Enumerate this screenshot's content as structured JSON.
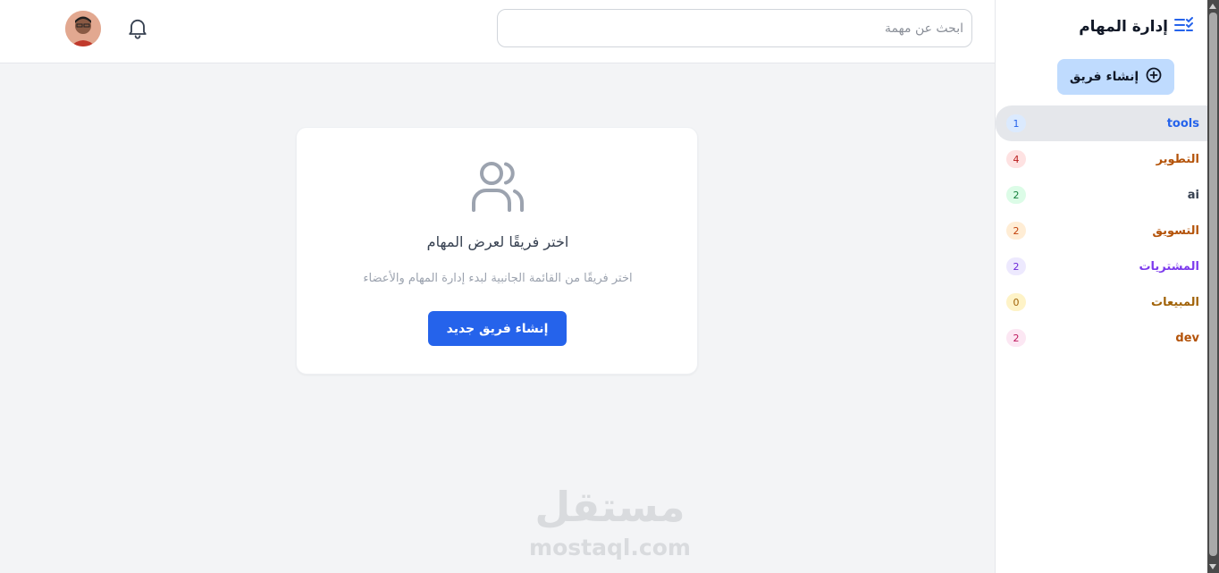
{
  "header": {
    "search_placeholder": "ابحث عن مهمة"
  },
  "sidebar": {
    "brand_title": "إدارة المهام",
    "create_team_label": "إنشاء فريق",
    "teams": [
      {
        "name": "tools",
        "count": "1",
        "color": "#2563eb",
        "badge_bg": "#dbeafe",
        "badge_fg": "#2563eb"
      },
      {
        "name": "التطوير",
        "count": "4",
        "color": "#b45309",
        "badge_bg": "#fee2e2",
        "badge_fg": "#b91c1c"
      },
      {
        "name": "ai",
        "count": "2",
        "color": "#374151",
        "badge_bg": "#dcfce7",
        "badge_fg": "#15803d"
      },
      {
        "name": "التسويق",
        "count": "2",
        "color": "#b45309",
        "badge_bg": "#ffedd5",
        "badge_fg": "#c2410c"
      },
      {
        "name": "المشتريات",
        "count": "2",
        "color": "#7c3aed",
        "badge_bg": "#ede9fe",
        "badge_fg": "#6d28d9"
      },
      {
        "name": "المبيعات",
        "count": "0",
        "color": "#a16207",
        "badge_bg": "#fef3c7",
        "badge_fg": "#a16207"
      },
      {
        "name": "dev",
        "count": "2",
        "color": "#b45309",
        "badge_bg": "#fce7f3",
        "badge_fg": "#be185d"
      }
    ]
  },
  "main": {
    "empty_title": "اختر فريقًا لعرض المهام",
    "empty_subtitle": "اختر فريقًا من القائمة الجانبية لبدء إدارة المهام والأعضاء",
    "new_team_button": "إنشاء فريق جديد"
  },
  "watermark": {
    "arabic": "مستقل",
    "latin": "mostaql.com"
  },
  "colors": {
    "accent": "#2563eb",
    "active_row": "#e5e7eb",
    "create_btn_bg": "#bfdbfe"
  },
  "icons": [
    "avatar",
    "bell-icon",
    "tasks-list-icon",
    "plus-circle-icon",
    "users-icon"
  ]
}
